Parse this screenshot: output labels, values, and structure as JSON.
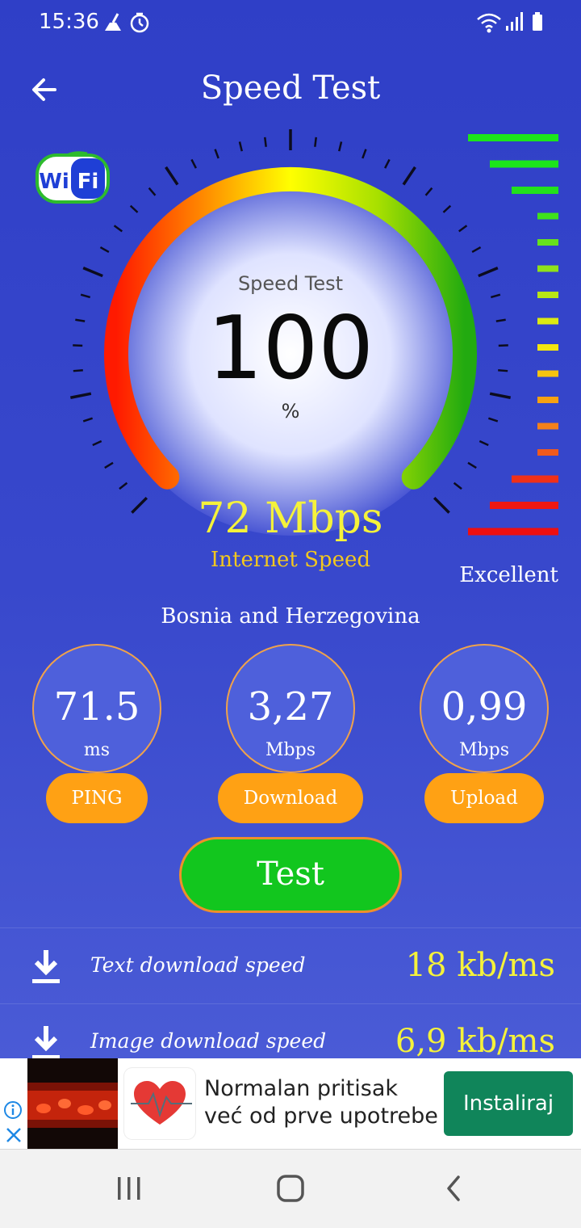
{
  "status_bar": {
    "time": "15:36"
  },
  "header": {
    "title": "Speed Test"
  },
  "wifi_logo": {
    "left": "Wi",
    "right": "Fi"
  },
  "gauge": {
    "label": "Speed Test",
    "value": "100",
    "unit": "%",
    "level_fraction": 1.0
  },
  "speed": {
    "value": "72 Mbps",
    "label": "Internet Speed"
  },
  "quality": {
    "label": "Excellent"
  },
  "country": "Bosnia and Herzegovina",
  "metrics": [
    {
      "value": "71.5",
      "unit": "ms",
      "label": "PING"
    },
    {
      "value": "3,27",
      "unit": "Mbps",
      "label": "Download"
    },
    {
      "value": "0,99",
      "unit": "Mbps",
      "label": "Upload"
    }
  ],
  "test_button": {
    "label": "Test"
  },
  "rows": [
    {
      "label": "Text download speed",
      "value": "18 kb/ms",
      "icon": "download-icon"
    },
    {
      "label": "Image download speed",
      "value": "6,9 kb/ms",
      "icon": "download-icon"
    }
  ],
  "ad": {
    "line1": "Normalan pritisak",
    "line2": "već od prve upotrebe",
    "button": "Instaliraj"
  },
  "colors": {
    "background": "#3848cc",
    "accent_yellow": "#f5f23a",
    "pill_orange": "#ffa114",
    "test_green": "#12c61e",
    "ad_button": "#10855a"
  },
  "icons": {
    "back": "arrow-left-icon",
    "status": [
      "cleaner-icon",
      "timer-icon",
      "wifi-signal-icon",
      "cell-signal-icon",
      "battery-icon"
    ],
    "nav": [
      "recents-icon",
      "home-icon",
      "back-nav-icon"
    ]
  }
}
